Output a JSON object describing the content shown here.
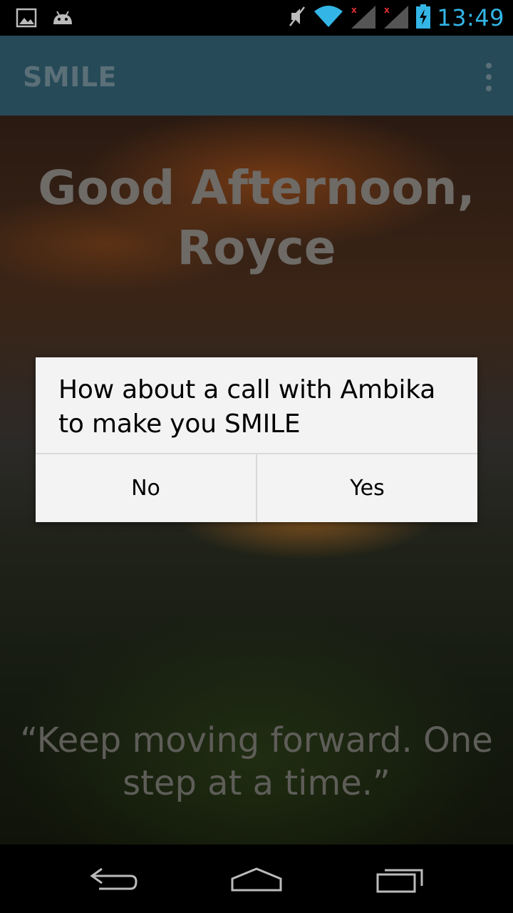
{
  "status_bar": {
    "time": "13:49",
    "left_icons": [
      "image-icon",
      "android-icon"
    ],
    "right_icons": [
      "mute-icon",
      "wifi-icon",
      "signal-icon",
      "signal-icon-2",
      "battery-charging-icon"
    ]
  },
  "action_bar": {
    "title": "SMILE",
    "menu_icon": "overflow-menu-icon"
  },
  "main": {
    "greeting": "Good Afternoon, Royce",
    "quote": "“Keep moving forward. One step at a time.”"
  },
  "dialog": {
    "message": "How about a call with Ambika to make you SMILE",
    "no_label": "No",
    "yes_label": "Yes"
  },
  "nav_bar": {
    "buttons": [
      "back-icon",
      "home-icon",
      "recents-icon"
    ]
  },
  "colors": {
    "status_time": "#33b5e5",
    "action_bar": "#264a58",
    "dialog_bg": "#f3f3f3"
  }
}
